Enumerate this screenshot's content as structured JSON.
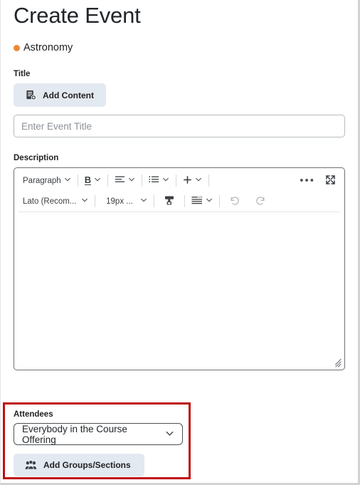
{
  "page": {
    "title": "Create Event"
  },
  "course": {
    "name": "Astronomy",
    "dot_color": "#e98a37"
  },
  "title_field": {
    "label": "Title",
    "add_content_button": "Add Content",
    "input_value": "",
    "input_placeholder": "Enter Event Title"
  },
  "description_field": {
    "label": "Description",
    "toolbar": {
      "row1": {
        "paragraph_style": "Paragraph",
        "bold_label": "B",
        "more_label": "•••"
      },
      "row2": {
        "font_family": "Lato (Recom...",
        "font_size": "19px ..."
      }
    },
    "body_text": ""
  },
  "attendees": {
    "label": "Attendees",
    "select_value": "Everybody in the Course Offering",
    "add_groups_button": "Add Groups/Sections",
    "highlight_color": "#c00f0f"
  }
}
